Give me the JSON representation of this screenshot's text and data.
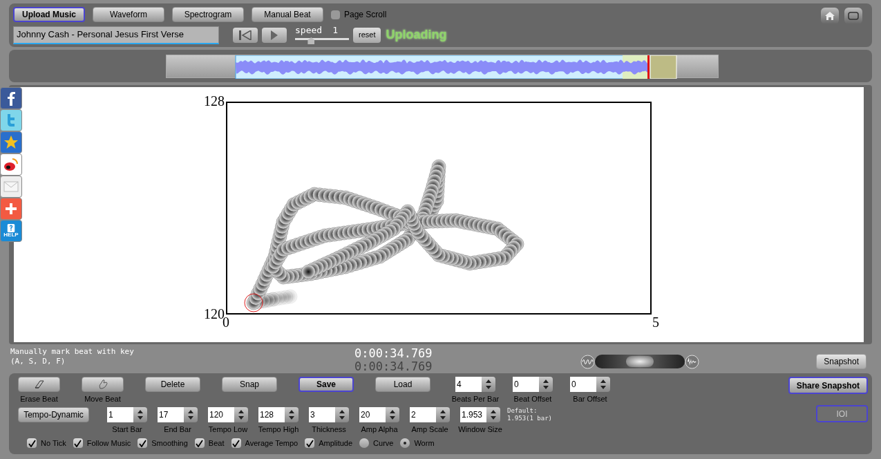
{
  "top_buttons": [
    {
      "label": "Upload Music",
      "selected": true
    },
    {
      "label": "Waveform",
      "selected": false
    },
    {
      "label": "Spectrogram",
      "selected": false
    },
    {
      "label": "Manual Beat",
      "selected": false
    }
  ],
  "page_scroll": {
    "label": "Page Scroll",
    "checked": false
  },
  "track_field": {
    "value": "Johnny Cash - Personal Jesus First Verse"
  },
  "speed": {
    "label": "speed",
    "reading": "1",
    "level": 0.3
  },
  "reset_button": "reset",
  "status": "Uploading",
  "social": [
    {
      "kind": "facebook"
    },
    {
      "kind": "twitter"
    },
    {
      "kind": "star"
    },
    {
      "kind": "weibo"
    },
    {
      "kind": "mail"
    },
    {
      "kind": "plus"
    },
    {
      "kind": "help",
      "label": "HELP"
    }
  ],
  "plot": {
    "y_max": "128",
    "y_min": "120",
    "x_min": "0",
    "x_max": "5"
  },
  "hint": [
    "Manually mark beat with key",
    "(A, S, D, F)"
  ],
  "times": [
    "0:00:34.769",
    "0:00:34.769"
  ],
  "mode_slider": {
    "level": 0.5
  },
  "snapshot_button": "Snapshot",
  "tool_buttons": [
    {
      "kind": "eraser",
      "label": "Erase Beat",
      "selected": false
    },
    {
      "kind": "hand",
      "label": "Move Beat",
      "selected": false
    },
    {
      "kind": "text",
      "label": "Delete",
      "selected": false
    },
    {
      "kind": "text",
      "label": "Snap",
      "selected": false
    },
    {
      "kind": "text",
      "label": "Save",
      "selected": true
    },
    {
      "kind": "text",
      "label": "Load",
      "selected": false
    }
  ],
  "spinners_row1": [
    {
      "value": "4",
      "label": "Beats Per Bar"
    },
    {
      "value": "0",
      "label": "Beat Offset"
    },
    {
      "value": "0",
      "label": "Bar Offset"
    }
  ],
  "tempo_button": "Tempo-Dynamic",
  "spinners_row2": [
    {
      "value": "1",
      "label": "Start Bar"
    },
    {
      "value": "17",
      "label": "End Bar"
    },
    {
      "value": "120",
      "label": "Tempo Low"
    },
    {
      "value": "128",
      "label": "Tempo High"
    },
    {
      "value": "3",
      "label": "Thickness"
    },
    {
      "value": "20",
      "label": "Amp Alpha"
    },
    {
      "value": "2",
      "label": "Amp Scale"
    },
    {
      "value": "1.953",
      "label": "Window Size"
    }
  ],
  "default_note": [
    "Default:",
    "1.953(1 bar)"
  ],
  "options": [
    {
      "kind": "checkbox",
      "label": "No Tick",
      "checked": true
    },
    {
      "kind": "checkbox",
      "label": "Follow Music",
      "checked": true
    },
    {
      "kind": "checkbox",
      "label": "Smoothing",
      "checked": true
    },
    {
      "kind": "checkbox",
      "label": "Beat",
      "checked": true
    },
    {
      "kind": "checkbox",
      "label": "Average Tempo",
      "checked": true
    },
    {
      "kind": "checkbox",
      "label": "Amplitude",
      "checked": true
    },
    {
      "kind": "radio",
      "label": "Curve",
      "checked": false
    },
    {
      "kind": "radio",
      "label": "Worm",
      "checked": true
    }
  ],
  "share_button": "Share Snapshot",
  "ioi_button": {
    "label": "IOI",
    "disabled": true
  }
}
